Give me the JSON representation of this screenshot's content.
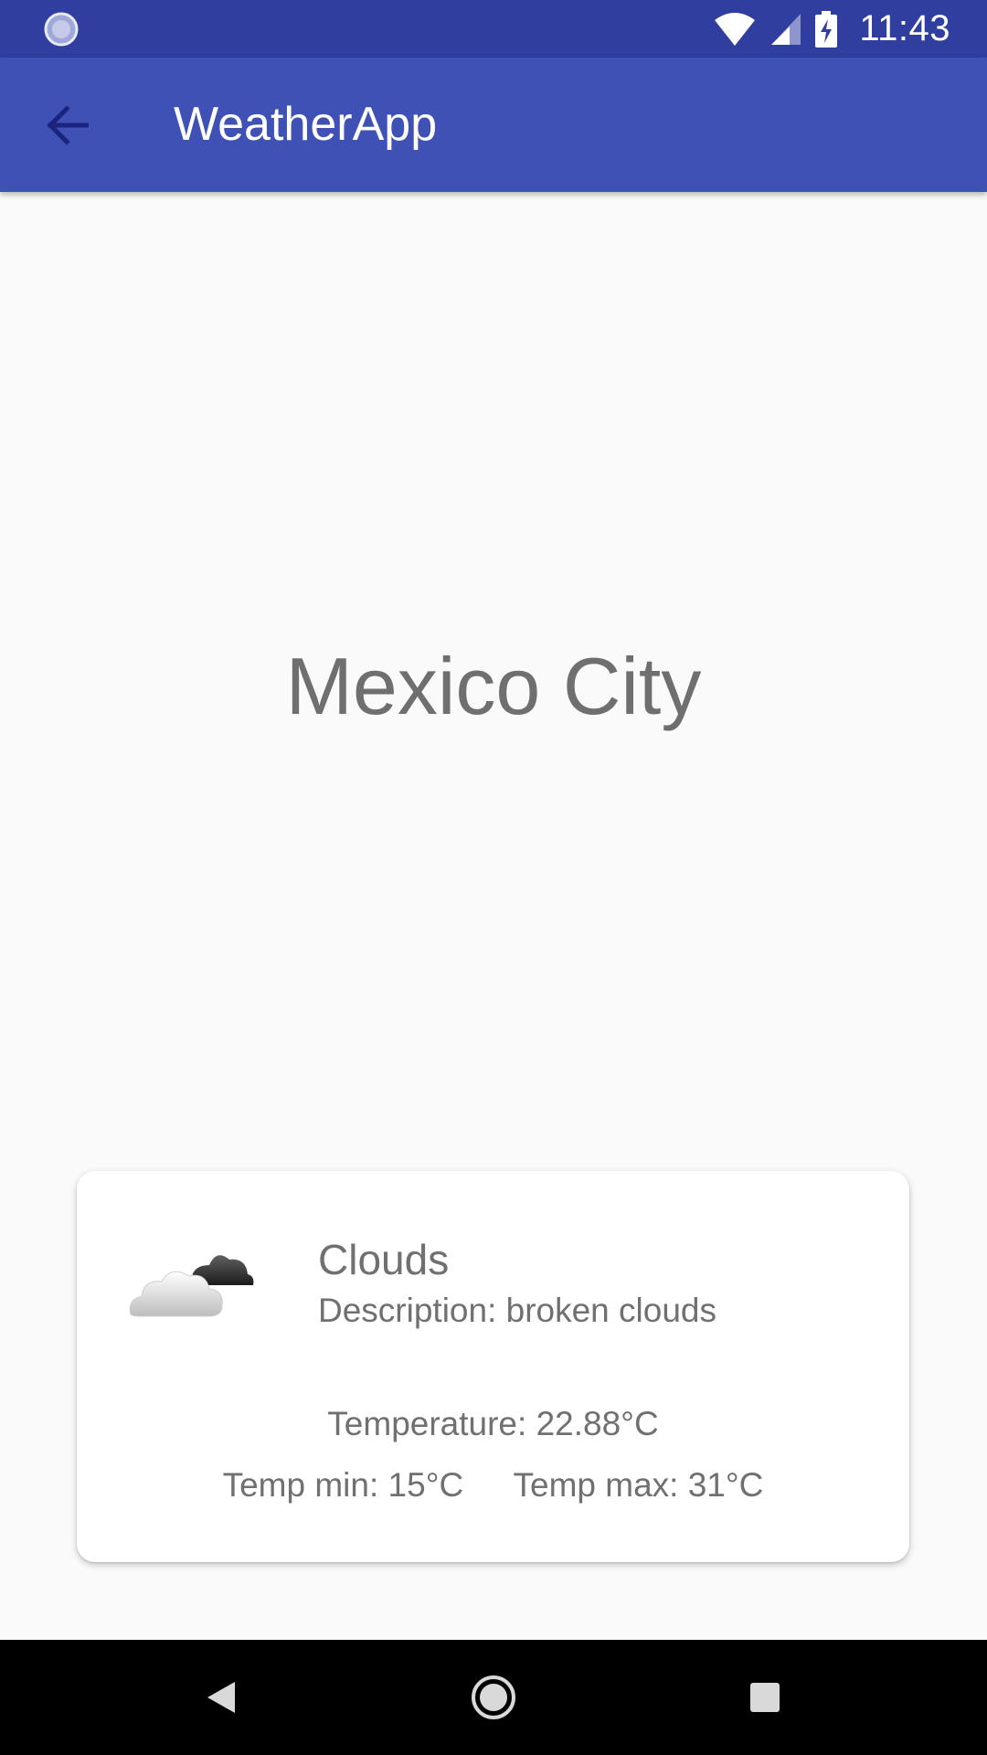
{
  "status_bar": {
    "time": "11:43",
    "left_icon": "loading-icon",
    "icons": [
      "wifi-icon",
      "cell-signal-icon",
      "battery-charging-icon"
    ]
  },
  "app_bar": {
    "title": "WeatherApp",
    "back_icon": "arrow-back-icon",
    "color": "#3f51b5",
    "status_color": "#303f9f"
  },
  "city": {
    "name": "Mexico City"
  },
  "weather_card": {
    "icon": "cloud-icon",
    "main": "Clouds",
    "description": "Description: broken clouds",
    "temperature": "Temperature: 22.88°C",
    "temp_min": "Temp min: 15°C",
    "temp_max": "Temp max: 31°C"
  },
  "nav_bar": {
    "icons": [
      "nav-back-icon",
      "nav-home-icon",
      "nav-recents-icon"
    ]
  }
}
